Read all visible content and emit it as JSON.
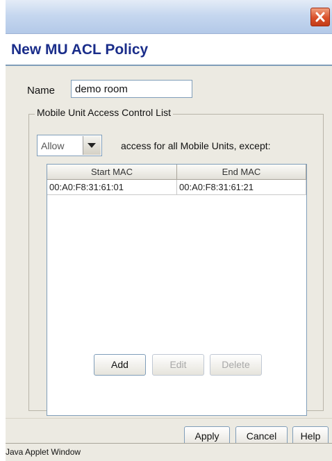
{
  "window": {
    "close_icon": "close-icon",
    "title": "New MU ACL Policy"
  },
  "form": {
    "name_label": "Name",
    "name_value": "demo room",
    "group_legend": "Mobile Unit Access Control List",
    "policy_select_value": "Allow",
    "access_text": "access for all Mobile Units, except:"
  },
  "table": {
    "columns": [
      "Start MAC",
      "End MAC"
    ],
    "rows": [
      [
        "00:A0:F8:31:61:01",
        "00:A0:F8:31:61:21"
      ]
    ]
  },
  "table_buttons": {
    "add": "Add",
    "edit": "Edit",
    "delete": "Delete"
  },
  "footer_buttons": {
    "apply": "Apply",
    "cancel": "Cancel",
    "help": "Help"
  },
  "status": "Java Applet Window",
  "colors": {
    "title": "#1a2d8a",
    "panel": "#eceae2",
    "close": "#d9502a"
  }
}
